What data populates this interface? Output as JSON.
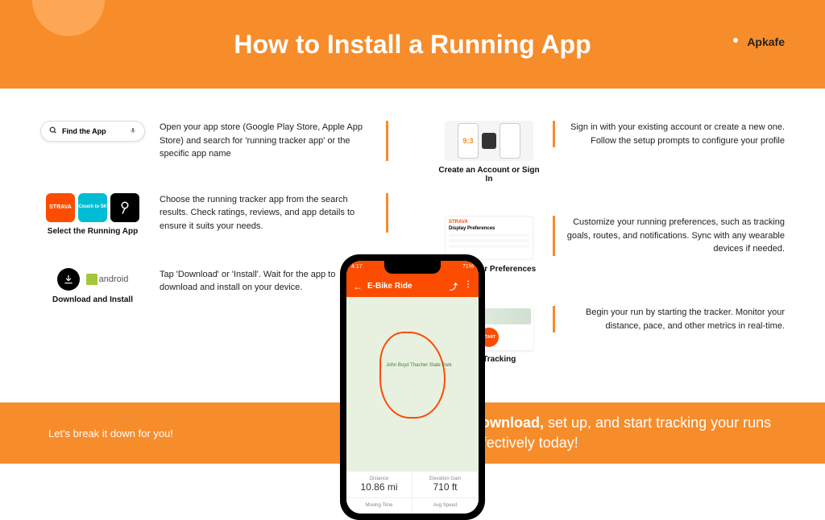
{
  "header": {
    "title": "How to Install a Running App",
    "brand": "Apkafe"
  },
  "steps": {
    "find": {
      "label": "Find the App",
      "desc": "Open your app store (Google Play Store, Apple App Store) and search for 'running tracker app' or the specific app name"
    },
    "select": {
      "label": "Select the Running App",
      "desc": "Choose the running tracker app from the search results. Check ratings, reviews, and app details to ensure it suits your needs.",
      "strava": "STRAVA",
      "couch": "Couch to 5K"
    },
    "download": {
      "label": "Download and Install",
      "desc": "Tap 'Download' or 'Install'. Wait for the app to download and install on your device.",
      "android": "android"
    },
    "account": {
      "label": "Create an Account or Sign In",
      "desc": "Sign in with your existing account or create a new one. Follow the setup prompts to configure your profile",
      "mock_time": "9:3"
    },
    "prefs": {
      "label": "Set Up Your Preferences",
      "desc": "Customize your running preferences, such as tracking goals, routes, and notifications. Sync with any wearable devices if needed.",
      "mock_brand": "STRAVA",
      "mock_panel": "Display Preferences"
    },
    "tracking": {
      "label": "Start Tracking",
      "desc": "Begin your run by starting the tracker. Monitor your distance, pace, and other metrics in real-time.",
      "start_btn": "START"
    }
  },
  "phone": {
    "status_left": "4:17",
    "status_right": "71%",
    "title": "E-Bike Ride",
    "park": "John Boyd Thacher State Park",
    "stats": {
      "distance_label": "Distance",
      "distance_value": "10.86 mi",
      "elev_label": "Elevation Gain",
      "elev_value": "710 ft",
      "time_label": "Moving Time",
      "speed_label": "Avg Speed"
    }
  },
  "footer": {
    "left": "Let's break it down for you!",
    "right_bold": "Download,",
    "right_rest": " set up, and start tracking your runs effectively today!"
  }
}
